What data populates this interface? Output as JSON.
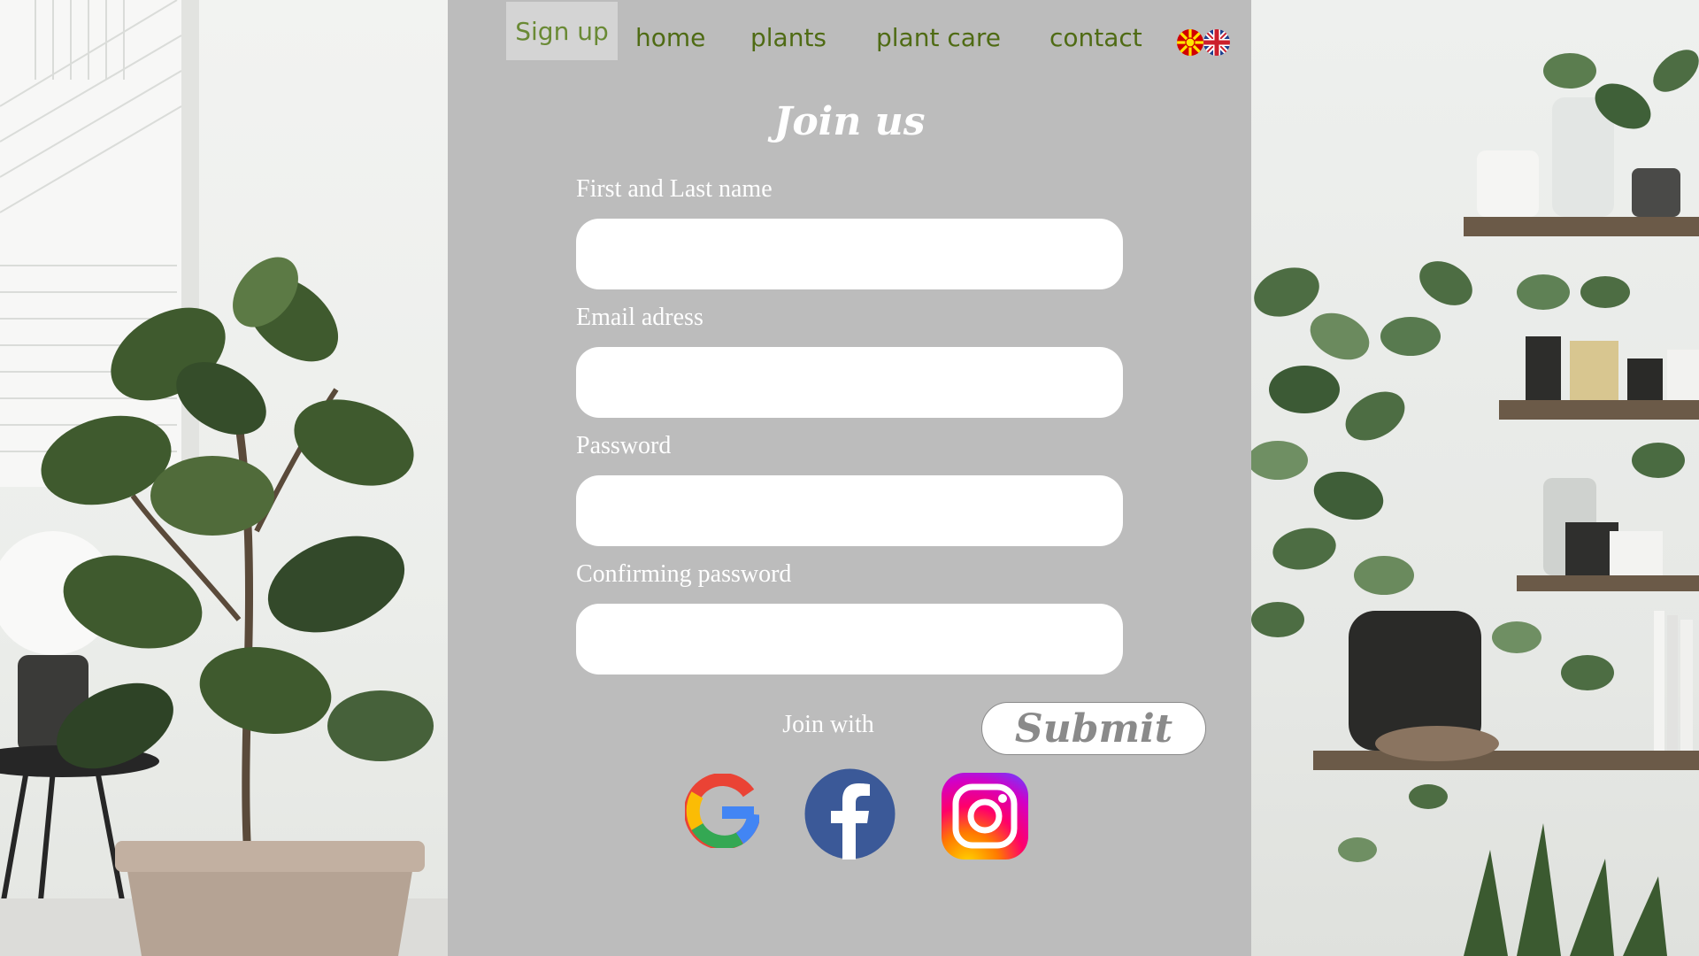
{
  "nav": {
    "signup_label": "Sign up",
    "links": [
      "home",
      "plants",
      "plant care",
      "contact"
    ],
    "languages": [
      "mk-flag-icon",
      "uk-flag-icon"
    ]
  },
  "form": {
    "title": "Join us",
    "fields": [
      {
        "label": "First and Last name",
        "value": ""
      },
      {
        "label": "Email adress",
        "value": ""
      },
      {
        "label": "Password",
        "value": ""
      },
      {
        "label": "Confirming password",
        "value": ""
      }
    ],
    "join_with": "Join with",
    "submit_label": "Submit",
    "social_icons": [
      "google-icon",
      "facebook-icon",
      "instagram-icon"
    ]
  },
  "colors": {
    "panel": "#bcbcbc",
    "nav_text": "#4f6b14",
    "facebook": "#3b5998"
  }
}
